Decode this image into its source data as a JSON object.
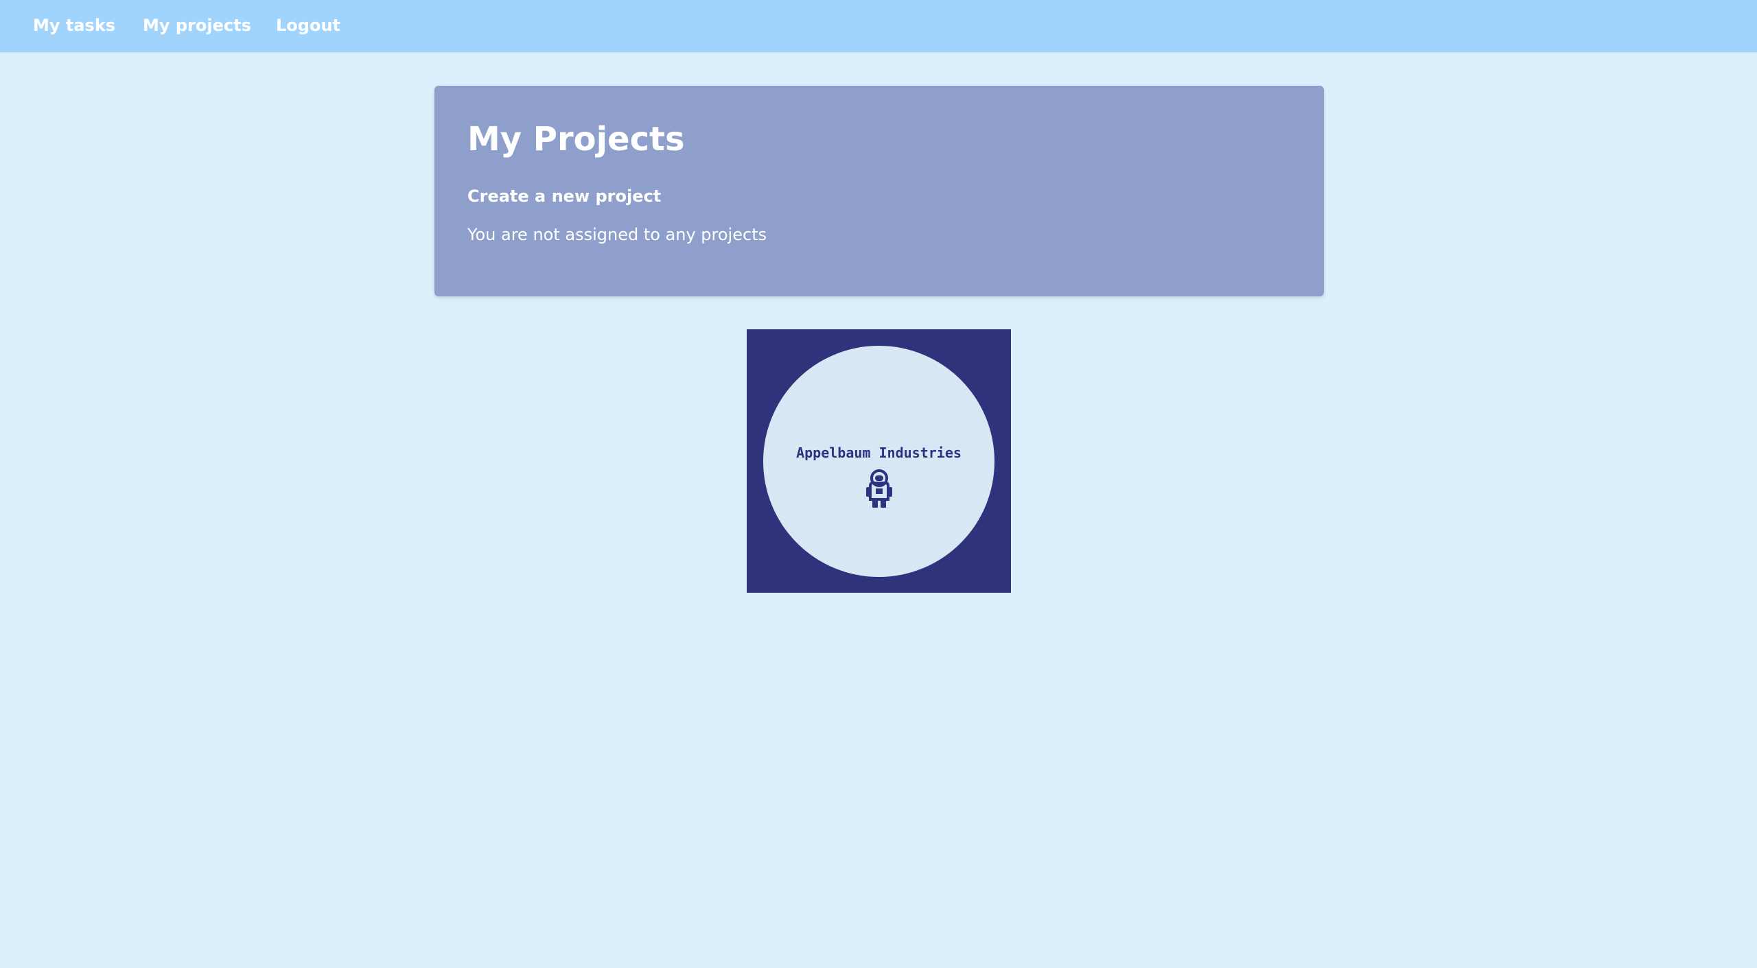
{
  "nav": {
    "my_tasks": "My tasks",
    "my_projects": "My projects",
    "logout": "Logout"
  },
  "main": {
    "title": "My Projects",
    "create_link": "Create a new project",
    "empty_message": "You are not assigned to any projects"
  },
  "logo": {
    "text": "Appelbaum Industries",
    "icon": "astronaut-icon"
  },
  "colors": {
    "background": "#daf0fd",
    "navbar": "#a1d4fd",
    "card": "#8f9fcc",
    "logo_dark": "#30327c",
    "logo_light": "#d7e7f4"
  }
}
